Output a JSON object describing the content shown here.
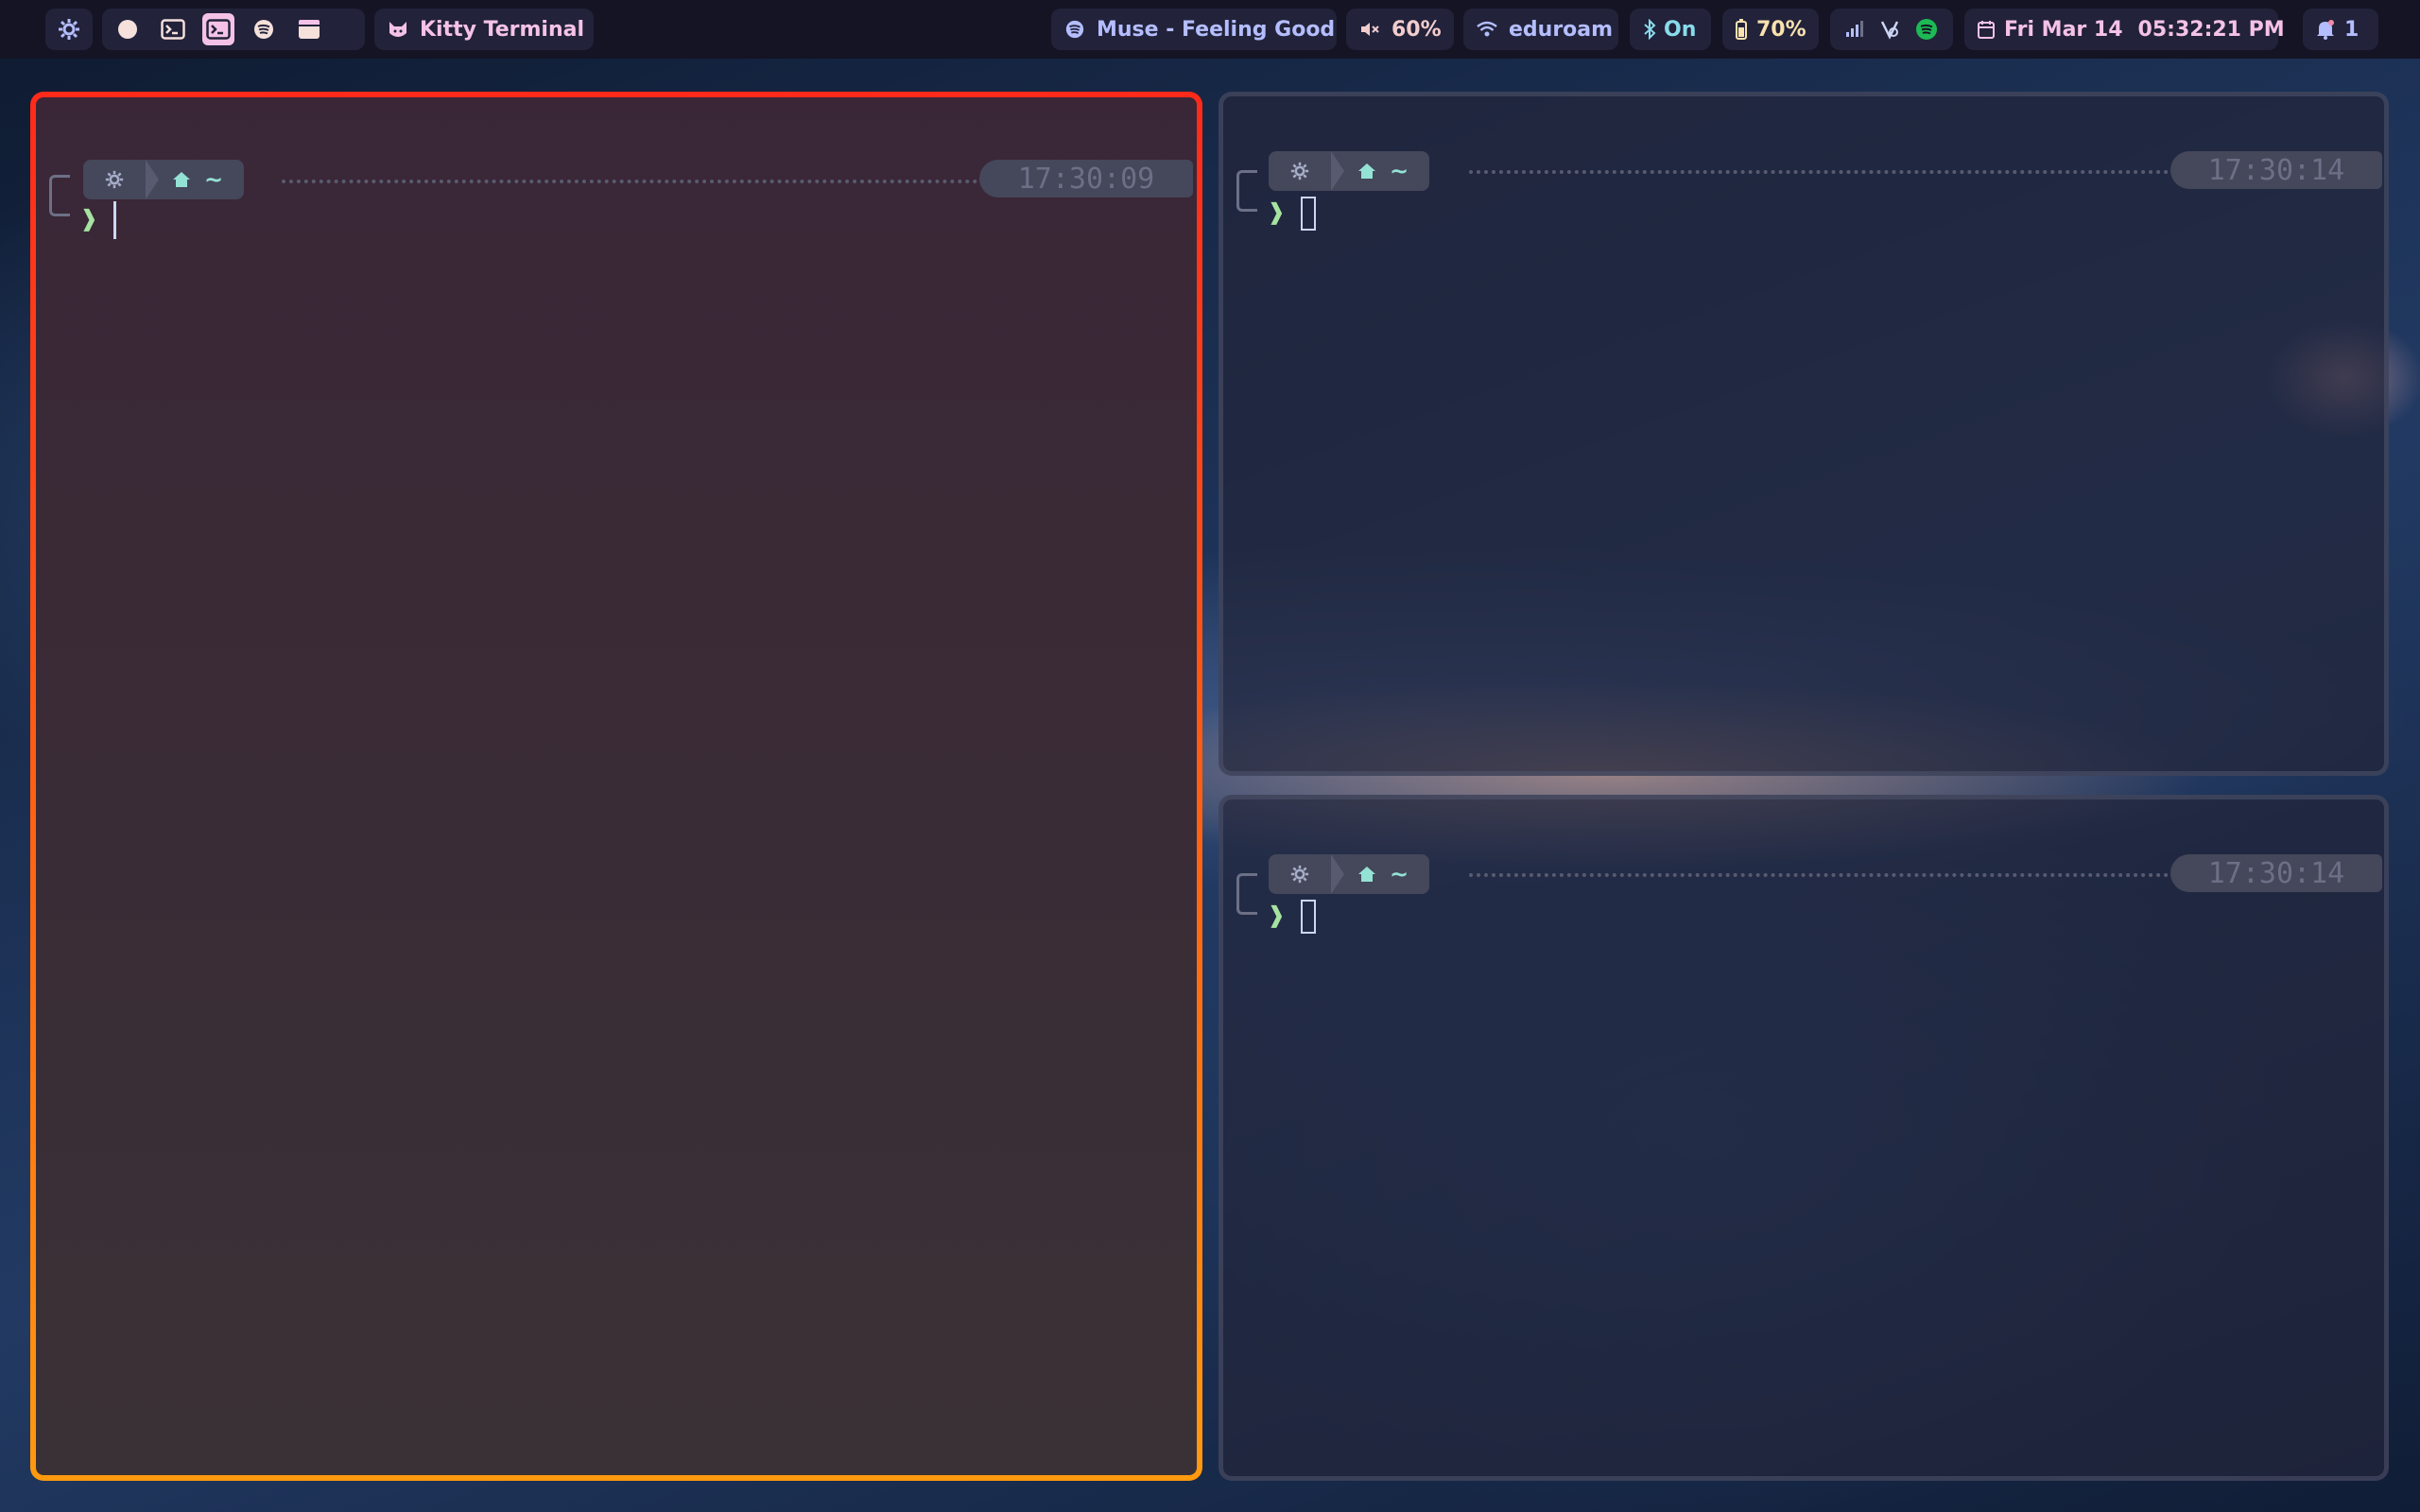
{
  "topbar": {
    "workspaces": [
      "firefox",
      "terminal",
      "terminal-active",
      "spotify",
      "files"
    ],
    "active_window": "Kitty Terminal",
    "media": "Muse - Feeling Good",
    "volume": "60%",
    "wifi": "eduroam",
    "bluetooth": "On",
    "battery": "70%",
    "date": "Fri Mar 14",
    "time": "05:32:21 PM",
    "notifications": "1"
  },
  "terminals": [
    {
      "id": "left",
      "focused": true,
      "path": "~",
      "clock": "17:30:09"
    },
    {
      "id": "top-right",
      "focused": false,
      "path": "~",
      "clock": "17:30:14"
    },
    {
      "id": "bottom-right",
      "focused": false,
      "path": "~",
      "clock": "17:30:14"
    }
  ],
  "colors": {
    "bar_bg": "#141424",
    "pill_bg": "#22223a",
    "accent_pink": "#f5c2e7",
    "lavender": "#b4befe",
    "teal": "#94e2d5",
    "green": "#a6e3a1",
    "focus_border_top": "#ff2a1a",
    "focus_border_bottom": "#ff9a0e"
  },
  "icons": {
    "launcher": "gear-icon",
    "media": "spotify-icon",
    "volume": "volume-muted-icon",
    "wifi": "wifi-icon",
    "bluetooth": "bluetooth-icon",
    "battery": "battery-icon",
    "calendar": "calendar-icon",
    "notification": "bell-icon"
  }
}
